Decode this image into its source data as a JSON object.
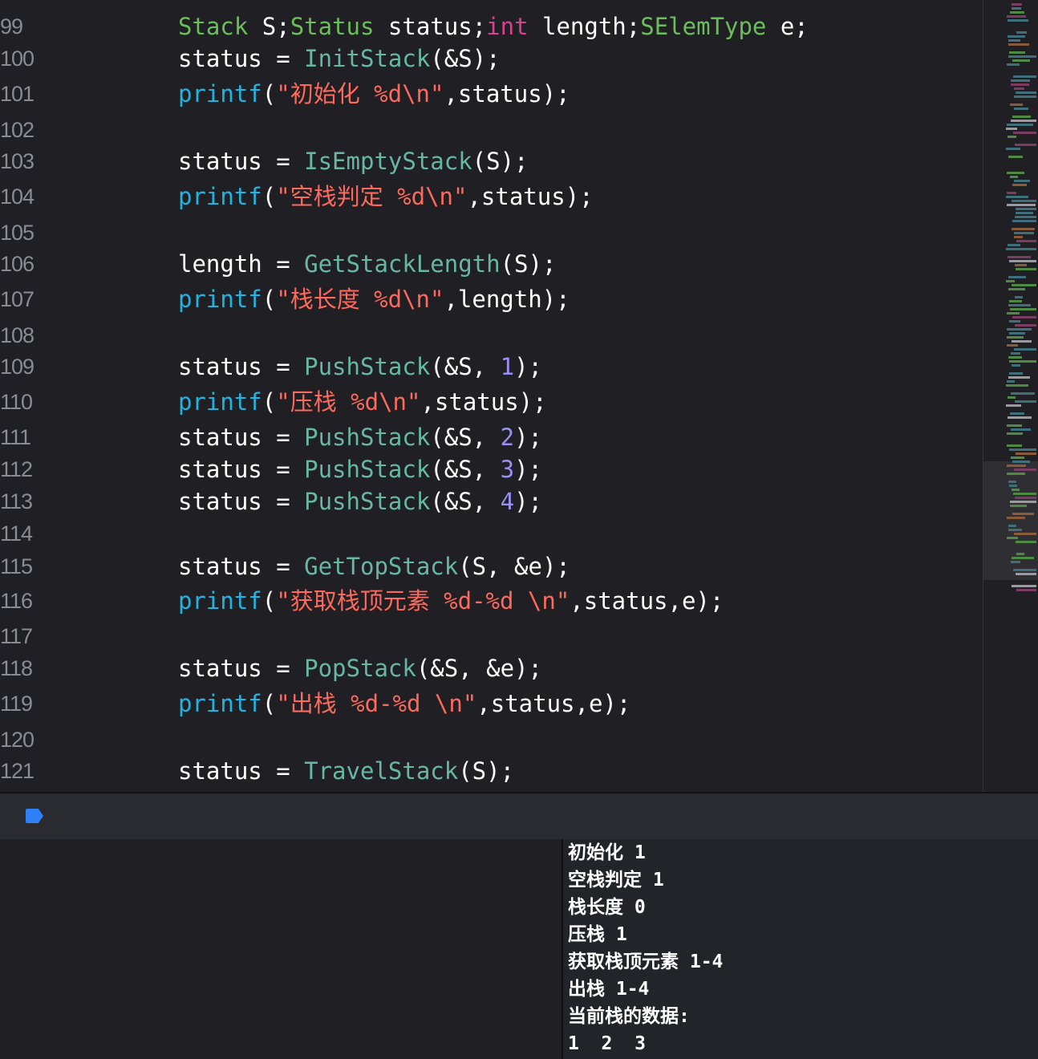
{
  "editor": {
    "lines": [
      {
        "num": "99",
        "tokens": [
          {
            "t": "Stack",
            "c": "type"
          },
          {
            "t": " S;",
            "c": "plain"
          },
          {
            "t": "Status",
            "c": "type"
          },
          {
            "t": " status;",
            "c": "plain"
          },
          {
            "t": "int",
            "c": "kw"
          },
          {
            "t": " length;",
            "c": "plain"
          },
          {
            "t": "SElemType",
            "c": "type"
          },
          {
            "t": " e;",
            "c": "plain"
          }
        ]
      },
      {
        "num": "100",
        "tokens": [
          {
            "t": "status = ",
            "c": "plain"
          },
          {
            "t": "InitStack",
            "c": "func"
          },
          {
            "t": "(&S);",
            "c": "plain"
          }
        ]
      },
      {
        "num": "101",
        "tokens": [
          {
            "t": "printf",
            "c": "call"
          },
          {
            "t": "(",
            "c": "plain"
          },
          {
            "t": "\"初始化 %d\\n\"",
            "c": "str"
          },
          {
            "t": ",status);",
            "c": "plain"
          }
        ]
      },
      {
        "num": "102",
        "tokens": []
      },
      {
        "num": "103",
        "tokens": [
          {
            "t": "status = ",
            "c": "plain"
          },
          {
            "t": "IsEmptyStack",
            "c": "func"
          },
          {
            "t": "(S);",
            "c": "plain"
          }
        ]
      },
      {
        "num": "104",
        "tokens": [
          {
            "t": "printf",
            "c": "call"
          },
          {
            "t": "(",
            "c": "plain"
          },
          {
            "t": "\"空栈判定 %d\\n\"",
            "c": "str"
          },
          {
            "t": ",status);",
            "c": "plain"
          }
        ]
      },
      {
        "num": "105",
        "tokens": []
      },
      {
        "num": "106",
        "tokens": [
          {
            "t": "length = ",
            "c": "plain"
          },
          {
            "t": "GetStackLength",
            "c": "func"
          },
          {
            "t": "(S);",
            "c": "plain"
          }
        ]
      },
      {
        "num": "107",
        "tokens": [
          {
            "t": "printf",
            "c": "call"
          },
          {
            "t": "(",
            "c": "plain"
          },
          {
            "t": "\"栈长度 %d\\n\"",
            "c": "str"
          },
          {
            "t": ",length);",
            "c": "plain"
          }
        ]
      },
      {
        "num": "108",
        "tokens": []
      },
      {
        "num": "109",
        "tokens": [
          {
            "t": "status = ",
            "c": "plain"
          },
          {
            "t": "PushStack",
            "c": "func"
          },
          {
            "t": "(&S, ",
            "c": "plain"
          },
          {
            "t": "1",
            "c": "num"
          },
          {
            "t": ");",
            "c": "plain"
          }
        ]
      },
      {
        "num": "110",
        "tokens": [
          {
            "t": "printf",
            "c": "call"
          },
          {
            "t": "(",
            "c": "plain"
          },
          {
            "t": "\"压栈 %d\\n\"",
            "c": "str"
          },
          {
            "t": ",status);",
            "c": "plain"
          }
        ]
      },
      {
        "num": "111",
        "tokens": [
          {
            "t": "status = ",
            "c": "plain"
          },
          {
            "t": "PushStack",
            "c": "func"
          },
          {
            "t": "(&S, ",
            "c": "plain"
          },
          {
            "t": "2",
            "c": "num"
          },
          {
            "t": ");",
            "c": "plain"
          }
        ]
      },
      {
        "num": "112",
        "tokens": [
          {
            "t": "status = ",
            "c": "plain"
          },
          {
            "t": "PushStack",
            "c": "func"
          },
          {
            "t": "(&S, ",
            "c": "plain"
          },
          {
            "t": "3",
            "c": "num"
          },
          {
            "t": ");",
            "c": "plain"
          }
        ]
      },
      {
        "num": "113",
        "tokens": [
          {
            "t": "status = ",
            "c": "plain"
          },
          {
            "t": "PushStack",
            "c": "func"
          },
          {
            "t": "(&S, ",
            "c": "plain"
          },
          {
            "t": "4",
            "c": "num"
          },
          {
            "t": ");",
            "c": "plain"
          }
        ]
      },
      {
        "num": "114",
        "tokens": []
      },
      {
        "num": "115",
        "tokens": [
          {
            "t": "status = ",
            "c": "plain"
          },
          {
            "t": "GetTopStack",
            "c": "func"
          },
          {
            "t": "(S, &e);",
            "c": "plain"
          }
        ]
      },
      {
        "num": "116",
        "tokens": [
          {
            "t": "printf",
            "c": "call"
          },
          {
            "t": "(",
            "c": "plain"
          },
          {
            "t": "\"获取栈顶元素 %d-%d \\n\"",
            "c": "str"
          },
          {
            "t": ",status,e);",
            "c": "plain"
          }
        ]
      },
      {
        "num": "117",
        "tokens": []
      },
      {
        "num": "118",
        "tokens": [
          {
            "t": "status = ",
            "c": "plain"
          },
          {
            "t": "PopStack",
            "c": "func"
          },
          {
            "t": "(&S, &e);",
            "c": "plain"
          }
        ]
      },
      {
        "num": "119",
        "tokens": [
          {
            "t": "printf",
            "c": "call"
          },
          {
            "t": "(",
            "c": "plain"
          },
          {
            "t": "\"出栈 %d-%d \\n\"",
            "c": "str"
          },
          {
            "t": ",status,e);",
            "c": "plain"
          }
        ]
      },
      {
        "num": "120",
        "tokens": []
      },
      {
        "num": "121",
        "tokens": [
          {
            "t": "status = ",
            "c": "plain"
          },
          {
            "t": "TravelStack",
            "c": "func"
          },
          {
            "t": "(S);",
            "c": "plain"
          }
        ]
      }
    ]
  },
  "debug_bar": {
    "breakpoint_icon": "breakpoint-arrow-icon"
  },
  "console": {
    "lines": [
      "初始化 1",
      "空栈判定 1",
      "栈长度 0",
      "压栈 1",
      "获取栈顶元素 1-4",
      "出栈 1-4",
      "当前栈的数据:",
      "1  2  3"
    ]
  },
  "colors": {
    "background": "#1f1f24",
    "type": "#6bbf59",
    "function": "#67b7a4",
    "call": "#20b4e0",
    "keyword": "#d3438f",
    "string": "#fc6a5d",
    "number": "#9a8ff5",
    "breakpoint": "#2f7ff6"
  }
}
